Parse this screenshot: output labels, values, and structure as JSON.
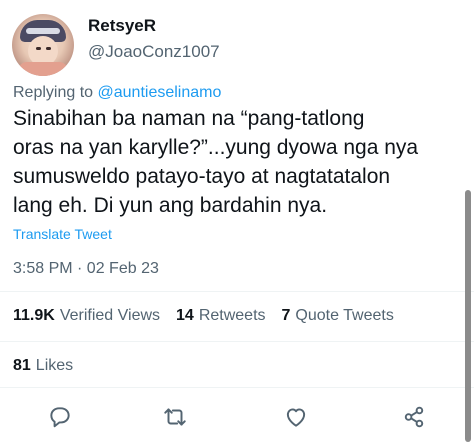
{
  "author": {
    "display_name": "RetsyeR",
    "handle": "@JoaoConz1007",
    "avatar_icon": "profile-avatar"
  },
  "reply": {
    "prefix": "Replying to ",
    "mention": "@auntieselinamo"
  },
  "body": "Sinabihan ba naman na “pang-tatlong\noras na yan karylle?”...yung dyowa nga nya\nsumusweldo patayo-tayo at nagtatatalon\nlang eh. Di yun ang bardahin nya.",
  "translate_label": "Translate Tweet",
  "timestamp": "3:58 PM · 02 Feb 23",
  "stats": {
    "views_count": "11.9K",
    "views_label": "Verified Views",
    "retweets_count": "14",
    "retweets_label": "Retweets",
    "quotes_count": "7",
    "quotes_label": "Quote Tweets"
  },
  "likes": {
    "count": "81",
    "label": "Likes"
  },
  "actions": {
    "reply_icon": "comment-icon",
    "retweet_icon": "retweet-icon",
    "like_icon": "heart-icon",
    "share_icon": "share-icon"
  },
  "colors": {
    "link": "#1d9bf0",
    "text": "#0f1419",
    "secondary": "#536471",
    "divider": "#eff3f4"
  }
}
